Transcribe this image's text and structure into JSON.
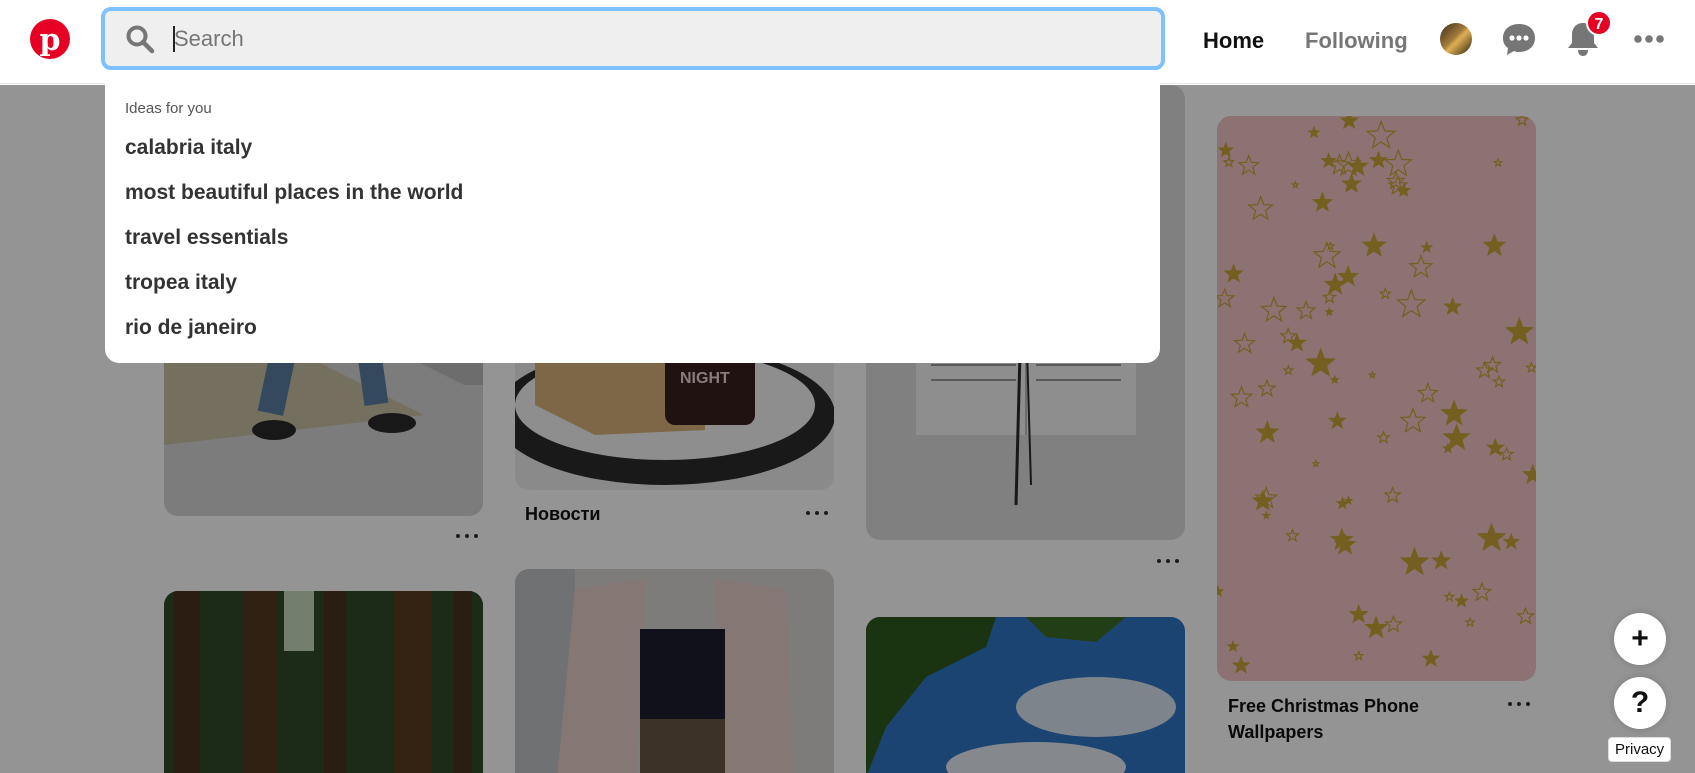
{
  "header": {
    "logo": "pinterest-logo",
    "search": {
      "value": "",
      "placeholder": "Search"
    },
    "nav": {
      "home": "Home",
      "following": "Following"
    },
    "notifications_count": "7"
  },
  "dropdown": {
    "heading": "Ideas for you",
    "items": [
      "calabria italy",
      "most beautiful places in the world",
      "travel essentials",
      "tropea italy",
      "rio de janeiro"
    ]
  },
  "pins": {
    "books_caption": "Новости",
    "christmas_caption_line1": "Free Christmas Phone",
    "christmas_caption_line2": "Wallpapers"
  },
  "floating": {
    "add": "+",
    "help": "?",
    "privacy": "Privacy"
  },
  "colors": {
    "brand": "#e60023",
    "focus": "#7fc1ff"
  }
}
